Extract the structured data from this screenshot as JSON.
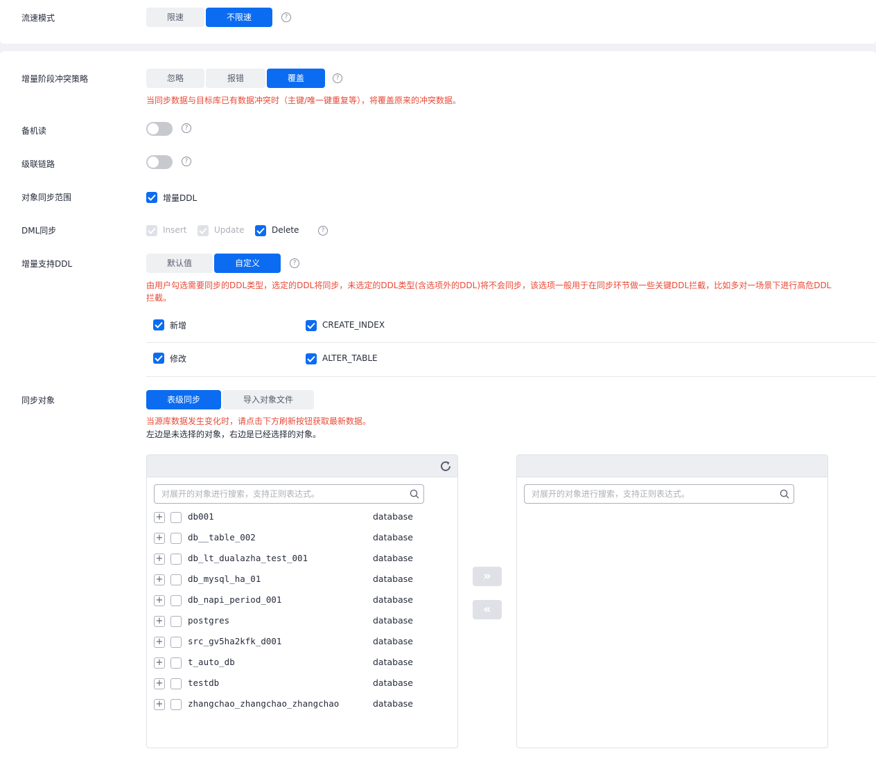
{
  "flow_mode": {
    "label": "流速模式",
    "options": [
      "限速",
      "不限速"
    ],
    "selected": "不限速"
  },
  "conflict_policy": {
    "label": "增量阶段冲突策略",
    "options": [
      "忽略",
      "报错",
      "覆盖"
    ],
    "selected": "覆盖",
    "hint": "当同步数据与目标库已有数据冲突时（主键/唯一键重复等），将覆盖原来的冲突数据。"
  },
  "standby_read": {
    "label": "备机读",
    "enabled": false
  },
  "cascade_link": {
    "label": "级联链路",
    "enabled": false
  },
  "object_scope": {
    "label": "对象同步范围",
    "option": "增量DDL",
    "checked": true
  },
  "dml_sync": {
    "label": "DML同步",
    "options": [
      {
        "name": "Insert",
        "checked": true,
        "disabled": true
      },
      {
        "name": "Update",
        "checked": true,
        "disabled": true
      },
      {
        "name": "Delete",
        "checked": true,
        "disabled": false
      }
    ]
  },
  "incremental_ddl": {
    "label": "增量支持DDL",
    "options": [
      "默认值",
      "自定义"
    ],
    "selected": "自定义",
    "hint": "由用户勾选需要同步的DDL类型，选定的DDL将同步，未选定的DDL类型(含选项外的DDL)将不会同步，该选项一般用于在同步环节做一些关键DDL拦截，比如多对一场景下进行高危DDL拦截。",
    "types": [
      {
        "name": "新增",
        "checked": true
      },
      {
        "name": "CREATE_INDEX",
        "checked": true
      },
      {
        "name": "修改",
        "checked": true
      },
      {
        "name": "ALTER_TABLE",
        "checked": true
      }
    ]
  },
  "sync_objects": {
    "label": "同步对象",
    "options": [
      "表级同步",
      "导入对象文件"
    ],
    "selected": "表级同步",
    "hint_warn": "当源库数据发生变化时，请点击下方刷新按钮获取最新数据。",
    "hint_note": "左边是未选择的对象，右边是已经选择的对象。",
    "search_placeholder": "对展开的对象进行搜索，支持正则表达式。",
    "left_items": [
      {
        "name": "db001",
        "type": "database"
      },
      {
        "name": "db__table_002",
        "type": "database"
      },
      {
        "name": "db_lt_dualazha_test_001",
        "type": "database"
      },
      {
        "name": "db_mysql_ha_01",
        "type": "database"
      },
      {
        "name": "db_napi_period_001",
        "type": "database"
      },
      {
        "name": "postgres",
        "type": "database"
      },
      {
        "name": "src_gv5ha2kfk_d001",
        "type": "database"
      },
      {
        "name": "t_auto_db",
        "type": "database"
      },
      {
        "name": "testdb",
        "type": "database"
      },
      {
        "name": "zhangchao_zhangchao_zhangchao",
        "type": "database"
      }
    ],
    "move_right": "»",
    "move_left": "«"
  },
  "colors": {
    "primary": "#0b6cf2",
    "warn": "#e84a37"
  }
}
